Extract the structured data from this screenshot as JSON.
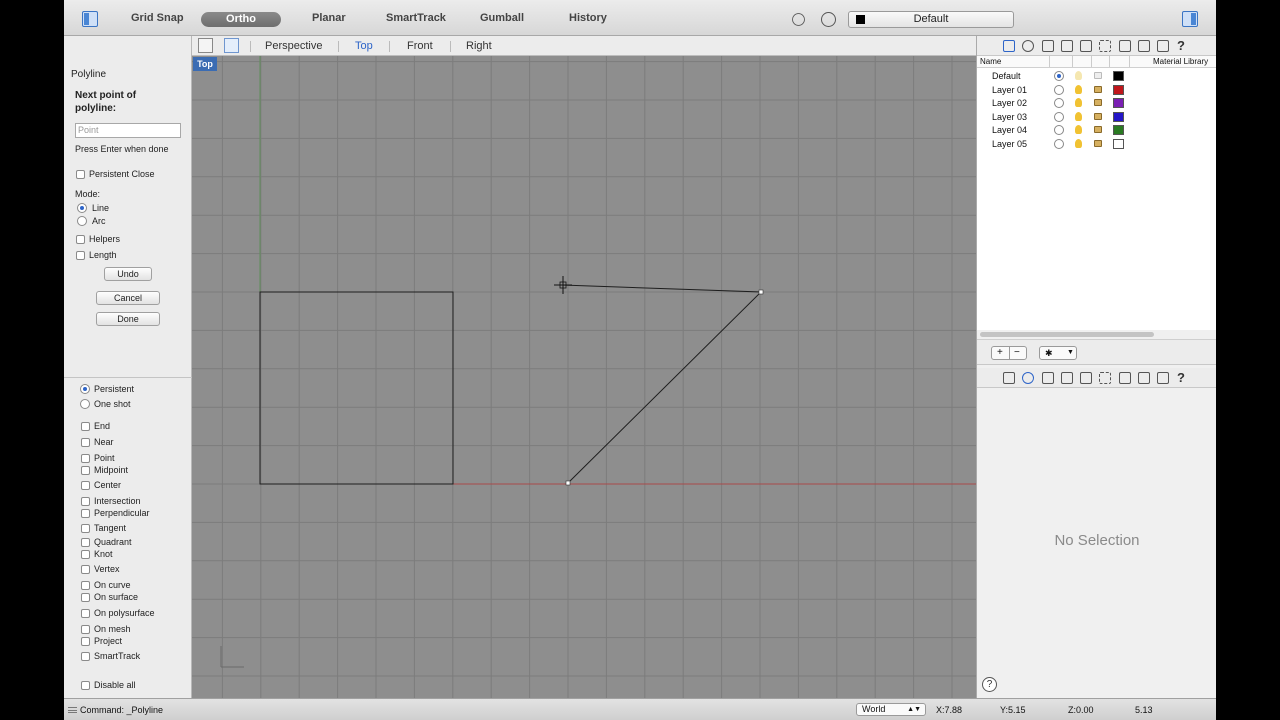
{
  "toolbar": {
    "items": [
      "Grid Snap",
      "Ortho",
      "Planar",
      "SmartTrack",
      "Gumball",
      "History"
    ],
    "active": "Ortho",
    "layer_value": "Default"
  },
  "viewports": {
    "tabs": [
      "Perspective",
      "Top",
      "Front",
      "Right"
    ],
    "active": "Top",
    "label": "Top"
  },
  "command_panel": {
    "title": "Polyline",
    "prompt": "Next point of polyline:",
    "input_placeholder": "Point",
    "hint": "Press Enter when done",
    "persistent_close": "Persistent Close",
    "mode_label": "Mode:",
    "modes": [
      {
        "label": "Line",
        "selected": true
      },
      {
        "label": "Arc",
        "selected": false
      }
    ],
    "helpers": "Helpers",
    "length": "Length",
    "undo": "Undo",
    "cancel": "Cancel",
    "done": "Done"
  },
  "osnap": {
    "persistent": "Persistent",
    "one_shot": "One shot",
    "items": [
      "End",
      "Near",
      "Point",
      "Midpoint",
      "Center",
      "Intersection",
      "Perpendicular",
      "Tangent",
      "Quadrant",
      "Knot",
      "Vertex",
      "On curve",
      "On surface",
      "On polysurface",
      "On mesh",
      "Project",
      "SmartTrack"
    ],
    "disable_all": "Disable all"
  },
  "layers": {
    "header_name": "Name",
    "header_material": "Material Library",
    "rows": [
      {
        "name": "Default",
        "color": "#000000",
        "current": true
      },
      {
        "name": "Layer 01",
        "color": "#c0161b",
        "current": false
      },
      {
        "name": "Layer 02",
        "color": "#7a1fb3",
        "current": false
      },
      {
        "name": "Layer 03",
        "color": "#2416c8",
        "current": false
      },
      {
        "name": "Layer 04",
        "color": "#2a7a22",
        "current": false
      },
      {
        "name": "Layer 05",
        "color": "#ffffff",
        "current": false
      }
    ]
  },
  "properties": {
    "no_selection": "No Selection",
    "help": "?"
  },
  "status": {
    "command": "Command: _Polyline",
    "cplane": "World",
    "x": "X:7.88",
    "y": "Y:5.15",
    "z": "Z:0.00",
    "dist": "5.13"
  }
}
